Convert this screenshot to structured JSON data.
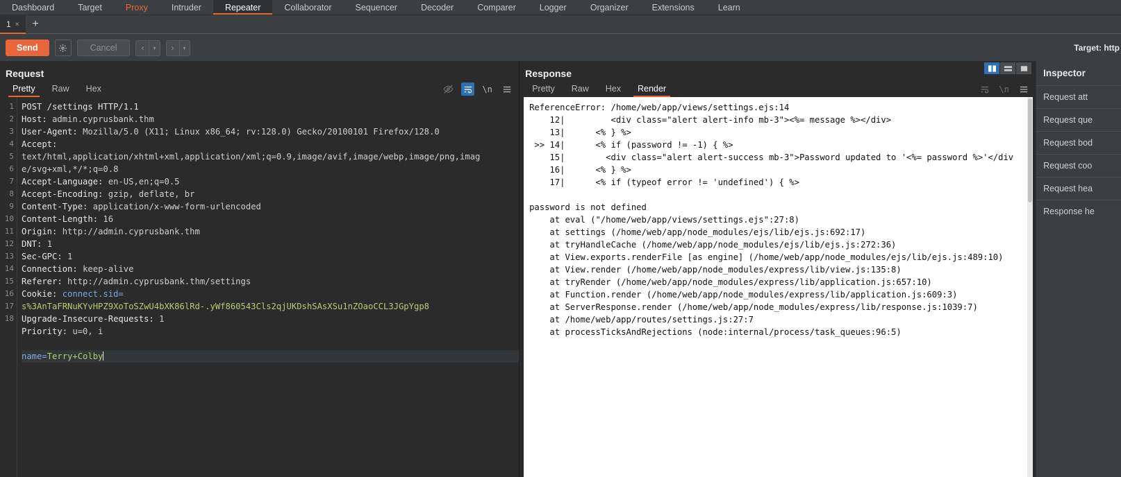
{
  "main_tabs": [
    {
      "label": "Dashboard",
      "state": "normal"
    },
    {
      "label": "Target",
      "state": "normal"
    },
    {
      "label": "Proxy",
      "state": "accent"
    },
    {
      "label": "Intruder",
      "state": "normal"
    },
    {
      "label": "Repeater",
      "state": "active"
    },
    {
      "label": "Collaborator",
      "state": "normal"
    },
    {
      "label": "Sequencer",
      "state": "normal"
    },
    {
      "label": "Decoder",
      "state": "normal"
    },
    {
      "label": "Comparer",
      "state": "normal"
    },
    {
      "label": "Logger",
      "state": "normal"
    },
    {
      "label": "Organizer",
      "state": "normal"
    },
    {
      "label": "Extensions",
      "state": "normal"
    },
    {
      "label": "Learn",
      "state": "normal"
    }
  ],
  "repeater_tabs": {
    "tab_label": "1",
    "close_glyph": "×",
    "add_glyph": "+"
  },
  "toolbar": {
    "send_label": "Send",
    "settings_icon": "gear-icon",
    "cancel_label": "Cancel",
    "back_glyph": "‹",
    "forward_glyph": "›",
    "dropdown_glyph": "▾",
    "target_label": "Target: http"
  },
  "request": {
    "title": "Request",
    "tabs": [
      {
        "label": "Pretty",
        "active": true
      },
      {
        "label": "Raw",
        "active": false
      },
      {
        "label": "Hex",
        "active": false
      }
    ],
    "tools": [
      {
        "name": "eye-off-icon",
        "state": "dim"
      },
      {
        "name": "word-wrap-icon",
        "state": "on"
      },
      {
        "name": "newline-icon",
        "state": "normal"
      },
      {
        "name": "menu-icon",
        "state": "normal"
      }
    ],
    "line_numbers": [
      "1",
      "2",
      "3",
      "4",
      "",
      "",
      "5",
      "6",
      "7",
      "8",
      "9",
      "10",
      "11",
      "12",
      "13",
      "14",
      "",
      "15",
      "16",
      "17",
      "18"
    ],
    "lines": [
      {
        "n": 1,
        "segs": [
          {
            "t": "POST /settings HTTP/1.1",
            "c": "k"
          }
        ]
      },
      {
        "n": 2,
        "segs": [
          {
            "t": "Host: ",
            "c": "k"
          },
          {
            "t": "admin.cyprusbank.thm",
            "c": "plain"
          }
        ]
      },
      {
        "n": 3,
        "segs": [
          {
            "t": "User-Agent: ",
            "c": "k"
          },
          {
            "t": "Mozilla/5.0 (X11; Linux x86_64; rv:128.0) Gecko/20100101 Firefox/128.0",
            "c": "plain"
          }
        ]
      },
      {
        "n": 4,
        "segs": [
          {
            "t": "Accept:",
            "c": "k"
          }
        ]
      },
      {
        "n": null,
        "segs": [
          {
            "t": "text/html,application/xhtml+xml,application/xml;q=0.9,image/avif,image/webp,image/png,imag",
            "c": "plain"
          }
        ]
      },
      {
        "n": null,
        "segs": [
          {
            "t": "e/svg+xml,*/*;q=0.8",
            "c": "plain"
          }
        ]
      },
      {
        "n": 5,
        "segs": [
          {
            "t": "Accept-Language: ",
            "c": "k"
          },
          {
            "t": "en-US,en;q=0.5",
            "c": "plain"
          }
        ]
      },
      {
        "n": 6,
        "segs": [
          {
            "t": "Accept-Encoding: ",
            "c": "k"
          },
          {
            "t": "gzip, deflate, br",
            "c": "plain"
          }
        ]
      },
      {
        "n": 7,
        "segs": [
          {
            "t": "Content-Type: ",
            "c": "k"
          },
          {
            "t": "application/x-www-form-urlencoded",
            "c": "plain"
          }
        ]
      },
      {
        "n": 8,
        "segs": [
          {
            "t": "Content-Length: ",
            "c": "k"
          },
          {
            "t": "16",
            "c": "plain"
          }
        ]
      },
      {
        "n": 9,
        "segs": [
          {
            "t": "Origin: ",
            "c": "k"
          },
          {
            "t": "http://admin.cyprusbank.thm",
            "c": "plain"
          }
        ]
      },
      {
        "n": 10,
        "segs": [
          {
            "t": "DNT: ",
            "c": "k"
          },
          {
            "t": "1",
            "c": "plain"
          }
        ]
      },
      {
        "n": 11,
        "segs": [
          {
            "t": "Sec-GPC: ",
            "c": "k"
          },
          {
            "t": "1",
            "c": "plain"
          }
        ]
      },
      {
        "n": 12,
        "segs": [
          {
            "t": "Connection: ",
            "c": "k"
          },
          {
            "t": "keep-alive",
            "c": "plain"
          }
        ]
      },
      {
        "n": 13,
        "segs": [
          {
            "t": "Referer: ",
            "c": "k"
          },
          {
            "t": "http://admin.cyprusbank.thm/settings",
            "c": "plain"
          }
        ]
      },
      {
        "n": 14,
        "segs": [
          {
            "t": "Cookie: ",
            "c": "k"
          },
          {
            "t": "connect.sid=",
            "c": "b"
          }
        ]
      },
      {
        "n": null,
        "segs": [
          {
            "t": "s%3AnTaFRNuKYvHPZ9XoToSZwU4bXK86lRd-.yWf860543Cls2qjUKDshSAsXSu1nZOaoCCL3JGpYgp8",
            "c": "g"
          }
        ]
      },
      {
        "n": 15,
        "segs": [
          {
            "t": "Upgrade-Insecure-Requests: ",
            "c": "k"
          },
          {
            "t": "1",
            "c": "plain"
          }
        ]
      },
      {
        "n": 16,
        "segs": [
          {
            "t": "Priority: ",
            "c": "k"
          },
          {
            "t": "u=0, i",
            "c": "plain"
          }
        ]
      },
      {
        "n": 17,
        "segs": [
          {
            "t": "",
            "c": "k"
          }
        ]
      },
      {
        "n": 18,
        "segs": [
          {
            "t": "name=",
            "c": "b"
          },
          {
            "t": "Terry+Colby",
            "c": "g"
          }
        ],
        "highlight": true,
        "caret": true
      }
    ]
  },
  "response": {
    "title": "Response",
    "tabs": [
      {
        "label": "Pretty",
        "active": false
      },
      {
        "label": "Raw",
        "active": false
      },
      {
        "label": "Hex",
        "active": false
      },
      {
        "label": "Render",
        "active": true
      }
    ],
    "layout_buttons": [
      {
        "name": "split-vertical-icon",
        "active": true
      },
      {
        "name": "split-horizontal-icon",
        "active": false
      },
      {
        "name": "single-pane-icon",
        "active": false
      }
    ],
    "tools": [
      {
        "name": "word-wrap-icon",
        "state": "dim"
      },
      {
        "name": "newline-icon",
        "state": "dim"
      },
      {
        "name": "menu-icon",
        "state": "normal"
      }
    ],
    "body_lines": [
      "ReferenceError: /home/web/app/views/settings.ejs:14",
      "    12|         <div class=\"alert alert-info mb-3\"><%= message %></div>",
      "    13|      <% } %>",
      " >> 14|      <% if (password != -1) { %>",
      "    15|        <div class=\"alert alert-success mb-3\">Password updated to '<%= password %>'</div",
      "    16|      <% } %>",
      "    17|      <% if (typeof error != 'undefined') { %>",
      "",
      "password is not defined",
      "    at eval (\"/home/web/app/views/settings.ejs\":27:8)",
      "    at settings (/home/web/app/node_modules/ejs/lib/ejs.js:692:17)",
      "    at tryHandleCache (/home/web/app/node_modules/ejs/lib/ejs.js:272:36)",
      "    at View.exports.renderFile [as engine] (/home/web/app/node_modules/ejs/lib/ejs.js:489:10)",
      "    at View.render (/home/web/app/node_modules/express/lib/view.js:135:8)",
      "    at tryRender (/home/web/app/node_modules/express/lib/application.js:657:10)",
      "    at Function.render (/home/web/app/node_modules/express/lib/application.js:609:3)",
      "    at ServerResponse.render (/home/web/app/node_modules/express/lib/response.js:1039:7)",
      "    at /home/web/app/routes/settings.js:27:7",
      "    at processTicksAndRejections (node:internal/process/task_queues:96:5)"
    ]
  },
  "inspector": {
    "title": "Inspector",
    "items": [
      "Request att",
      "Request que",
      "Request bod",
      "Request coo",
      "Request hea",
      "Response he"
    ]
  },
  "colors": {
    "accent": "#e8663a",
    "toggle_active": "#2f6fb3",
    "panel_bg": "#3c3f41",
    "editor_bg": "#2b2b2b",
    "string_green": "#b5cc72",
    "key_blue": "#7fa8dd"
  }
}
